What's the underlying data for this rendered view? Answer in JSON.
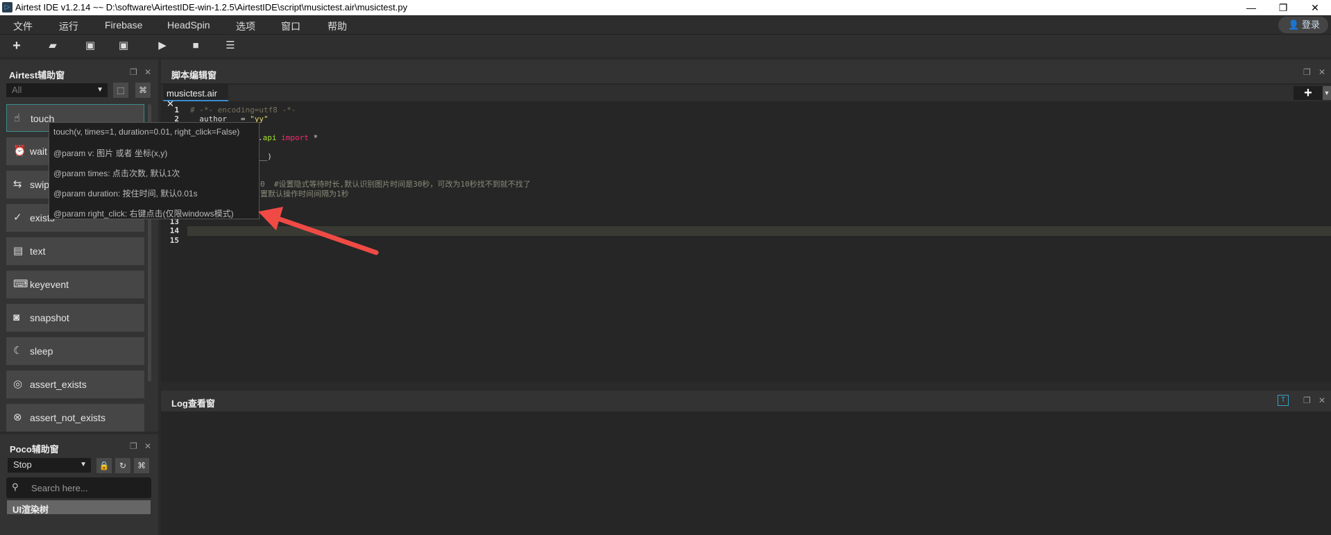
{
  "window": {
    "title": "Airtest IDE v1.2.14 ~~ D:\\software\\AirtestIDE-win-1.2.5\\AirtestIDE\\script\\musictest.air\\musictest.py",
    "minimize": "—",
    "restore": "❐",
    "close": "✕"
  },
  "menu": [
    "文件",
    "运行",
    "Firebase",
    "HeadSpin",
    "选项",
    "窗口",
    "帮助"
  ],
  "login": "登录",
  "toolbar": {
    "icons": [
      "plus-icon",
      "folder-open-icon",
      "save-icon",
      "save-as-icon",
      "play-icon",
      "stop-icon",
      "log-list-icon"
    ]
  },
  "airtest_panel": {
    "title": "Airtest辅助窗",
    "filter": "All",
    "items": [
      "touch",
      "wait",
      "swipe",
      "exists",
      "text",
      "keyevent",
      "snapshot",
      "sleep",
      "assert_exists",
      "assert_not_exists"
    ]
  },
  "tooltip": [
    "touch(v, times=1, duration=0.01, right_click=False)",
    "@param v: 图片 或者 坐标(x,y)",
    "@param times: 点击次数, 默认1次",
    "@param duration: 按住时间, 默认0.01s",
    "@param right_click: 右键点击(仅限windows模式)"
  ],
  "poco_panel": {
    "title": "Poco辅助窗",
    "mode": "Stop",
    "search_placeholder": "Search here...",
    "tree_header": "UI渲染树"
  },
  "editor": {
    "title": "脚本编辑窗",
    "tab": "musictest.air",
    "tab_close": "✕",
    "lines": [
      {
        "n": "1",
        "t": "# -*- encoding=utf8 -*-"
      },
      {
        "n": "2",
        "t": "__author__ = \"yy\""
      },
      {
        "n": "4",
        "t": ".api import *"
      },
      {
        "n": "6",
        "t": "__)"
      },
      {
        "n": "9",
        "t": "0  #设置隐式等待时长,默认识别图片时间是30秒，可改为10秒找不到就不找了"
      },
      {
        "n": "10",
        "t": "置默认操作时间间隔为1秒"
      },
      {
        "n": "13",
        "t": ""
      },
      {
        "n": "14",
        "t": ""
      },
      {
        "n": "15",
        "t": ""
      }
    ]
  },
  "log_panel": {
    "title": "Log查看窗"
  },
  "colors": {
    "accent": "#3aa0c8",
    "arrow": "#f04a45",
    "string": "#e6db74",
    "keyword": "#f92672",
    "comment": "#75715e"
  }
}
